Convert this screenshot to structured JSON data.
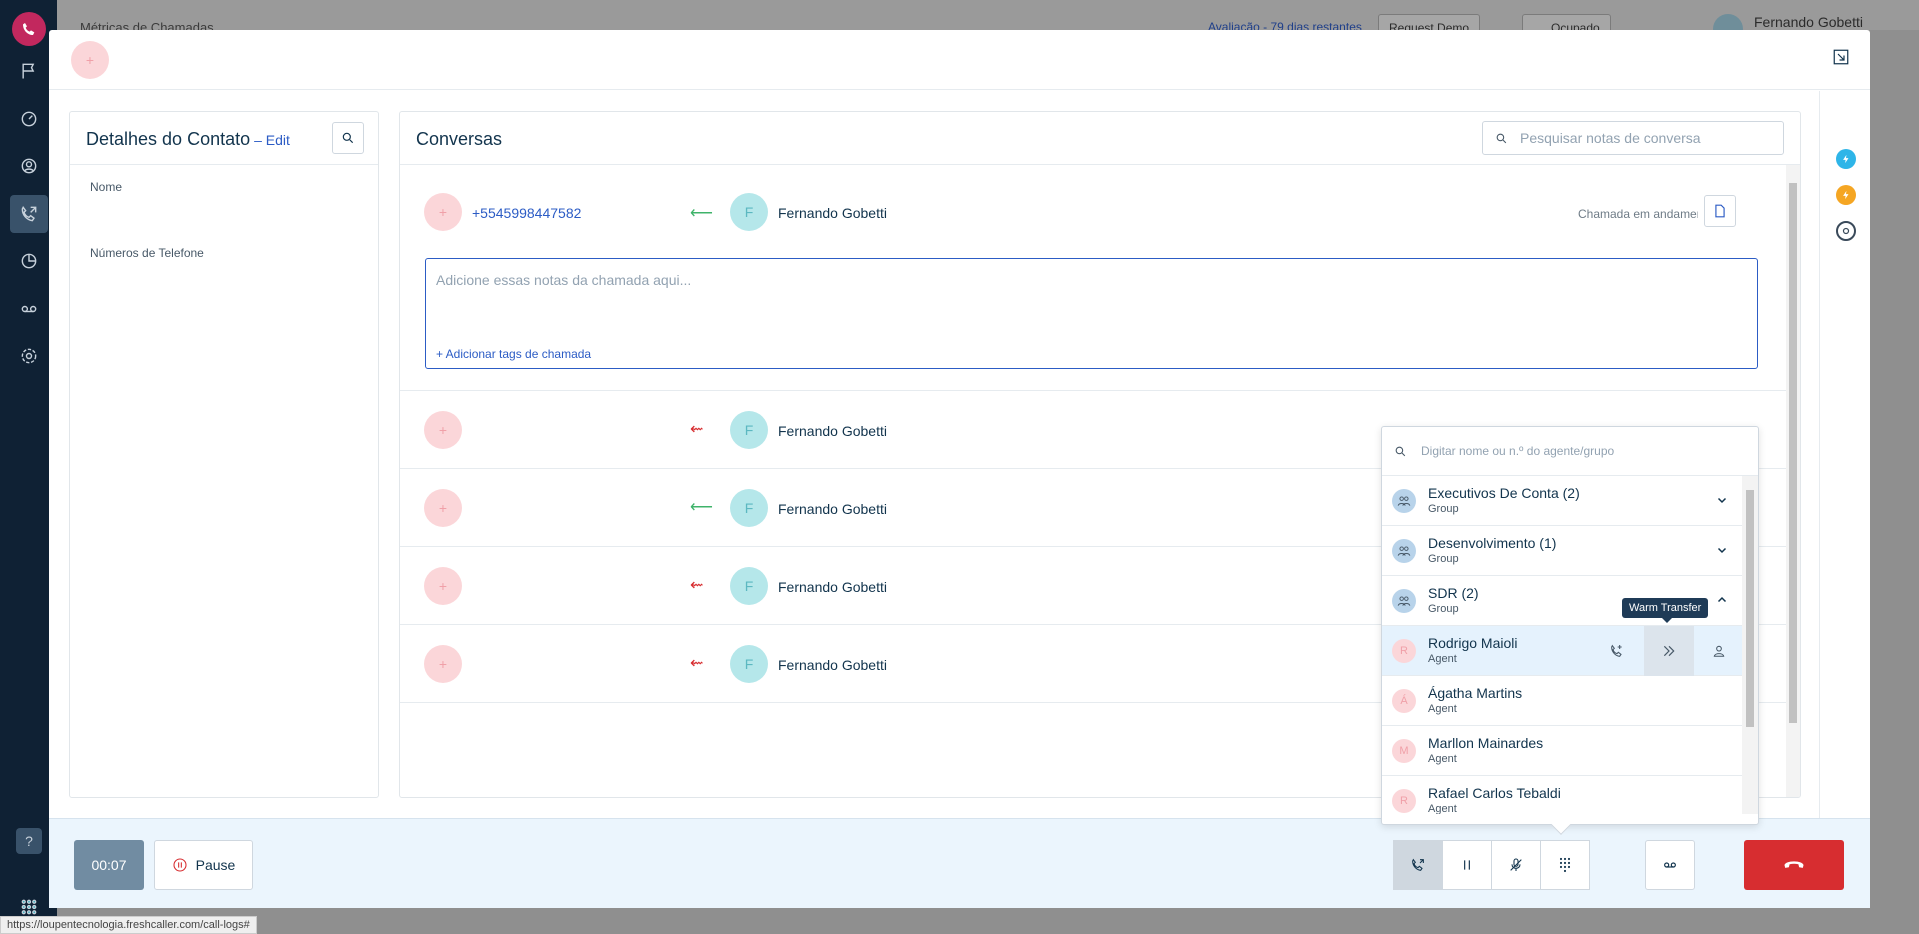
{
  "background": {
    "page_title": "Métricas de Chamadas",
    "trial_text": "Avaliação - 79 dias restantes",
    "request_demo": "Request Demo",
    "status_chip": "Ocupado",
    "user_name": "Fernando Gobetti",
    "status_url": "https://loupentecnologia.freshcaller.com/call-logs#"
  },
  "contact": {
    "title": "Detalhes do Contato",
    "edit": "– Edit",
    "name_label": "Nome",
    "phones_label": "Números de Telefone"
  },
  "conversations": {
    "title": "Conversas",
    "search_placeholder": "Pesquisar notas de conversa",
    "notes_placeholder": "Adicione essas notas da chamada aqui...",
    "add_tags": "+ Adicionar tags de chamada",
    "rows": [
      {
        "phone": "+5545998447582",
        "direction": "incoming",
        "agent_initial": "F",
        "agent": "Fernando Gobetti",
        "status": "Chamada em andamento"
      },
      {
        "phone": "",
        "direction": "missed",
        "agent_initial": "F",
        "agent": "Fernando Gobetti",
        "status": ""
      },
      {
        "phone": "",
        "direction": "incoming",
        "agent_initial": "F",
        "agent": "Fernando Gobetti",
        "status": ""
      },
      {
        "phone": "",
        "direction": "missed",
        "agent_initial": "F",
        "agent": "Fernando Gobetti",
        "status": ""
      },
      {
        "phone": "",
        "direction": "missed",
        "agent_initial": "F",
        "agent": "Fernando Gobetti",
        "status": ""
      }
    ]
  },
  "transfer": {
    "search_placeholder": "Digitar nome ou n.º do agente/grupo",
    "tooltip": "Warm Transfer",
    "items": [
      {
        "name": "Executivos De Conta (2)",
        "type": "Group",
        "kind": "group"
      },
      {
        "name": "Desenvolvimento (1)",
        "type": "Group",
        "kind": "group"
      },
      {
        "name": "SDR (2)",
        "type": "Group",
        "kind": "group"
      },
      {
        "name": "Rodrigo Maioli",
        "type": "Agent",
        "kind": "agent",
        "initial": "R"
      },
      {
        "name": "Ágatha Martins",
        "type": "Agent",
        "kind": "agent",
        "initial": "Á"
      },
      {
        "name": "Marllon Mainardes",
        "type": "Agent",
        "kind": "agent",
        "initial": "M"
      },
      {
        "name": "Rafael Carlos Tebaldi",
        "type": "Agent",
        "kind": "agent",
        "initial": "R"
      }
    ]
  },
  "footer": {
    "timer": "00:07",
    "pause": "Pause"
  },
  "plus_glyph": "+",
  "colors": {
    "accent": "#2c5cc5",
    "hangup": "#d72d30",
    "incoming": "#3fb36a",
    "missed": "#d72d30"
  }
}
